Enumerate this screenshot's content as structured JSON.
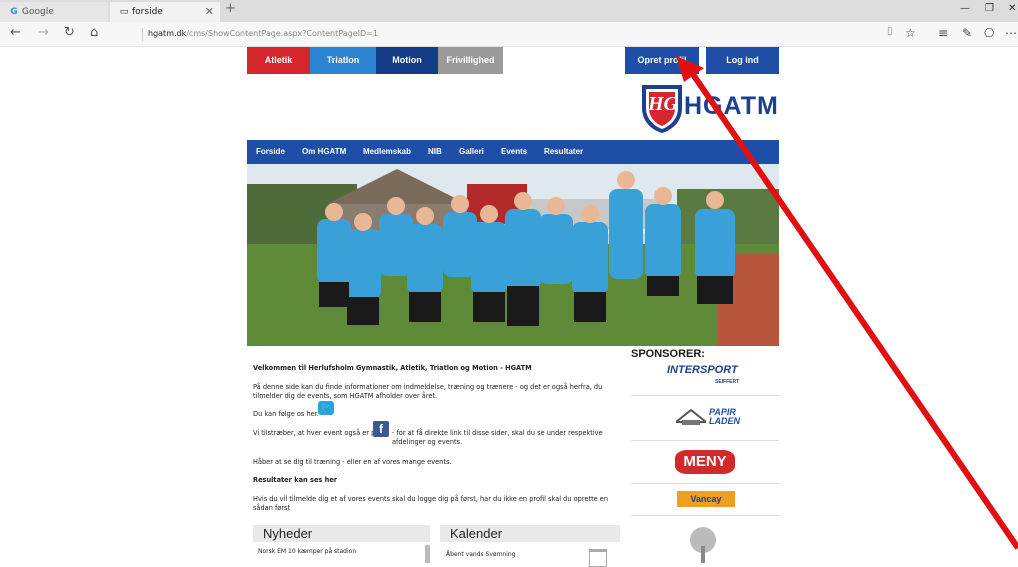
{
  "browser": {
    "tabs": [
      {
        "label": "Google",
        "icon": "google-icon"
      },
      {
        "label": "forside",
        "icon": "page-icon"
      }
    ],
    "url_host": "hgatm.dk",
    "url_path": "/cms/ShowContentPage.aspx?ContentPageID=1"
  },
  "site": {
    "top_nav": [
      {
        "label": "Atletik",
        "color": "#d6262e"
      },
      {
        "label": "Triatlon",
        "color": "#2a84d2"
      },
      {
        "label": "Motion",
        "color": "#143b86"
      },
      {
        "label": "Frivillighed",
        "color": "#9a9a9a"
      }
    ],
    "account_buttons": [
      {
        "label": "Opret profil",
        "color": "#1f4ea6"
      },
      {
        "label": "Log ind",
        "color": "#1f4ea6"
      }
    ],
    "logo_text": "HGATM",
    "shield_letters": "HG",
    "main_nav": [
      "Forside",
      "Om HGATM",
      "Medlemskab",
      "NIB",
      "Galleri",
      "Events",
      "Resultater"
    ],
    "welcome_title": "Velkommen til Herlufsholm Gymnastik, Atletik, Triatlon og Motion - HGATM",
    "intro": "På denne side kan du finde informationer om indmeldelse, træning og trænere - og det er også herfra, du tilmelder dig de events, som HGATM afholder over året.",
    "follow": "Du kan følge os her.",
    "facebook_line_a": "Vi tilstræber, at hver event også er på",
    "facebook_line_b": "- for at få direkte link til disse sider, skal du se under respektive afdelinger og events.",
    "hope": "Håber at se dig til træning - eller en af vores mange events.",
    "results_link": "Resultater kan ses her",
    "signup_note": "Hvis du vil tilmelde dig et af vores events skal du logge dig på først, har du ikke en profil skal du oprette en sådan først",
    "sponsors_title": "SPONSORER:",
    "sponsors": [
      {
        "name": "INTERSPORT",
        "sub": "SEIFFERT"
      },
      {
        "name": "PAPIR LADEN"
      },
      {
        "name": "MENY"
      },
      {
        "name": "Vancay"
      },
      {
        "name": "tree-logo"
      }
    ],
    "news_title": "Nyheder",
    "news_items": [
      "Norsk EM 10 kæmper på stadion"
    ],
    "calendar_title": "Kalender",
    "calendar_items": [
      "Åbent vands Svømning"
    ]
  }
}
